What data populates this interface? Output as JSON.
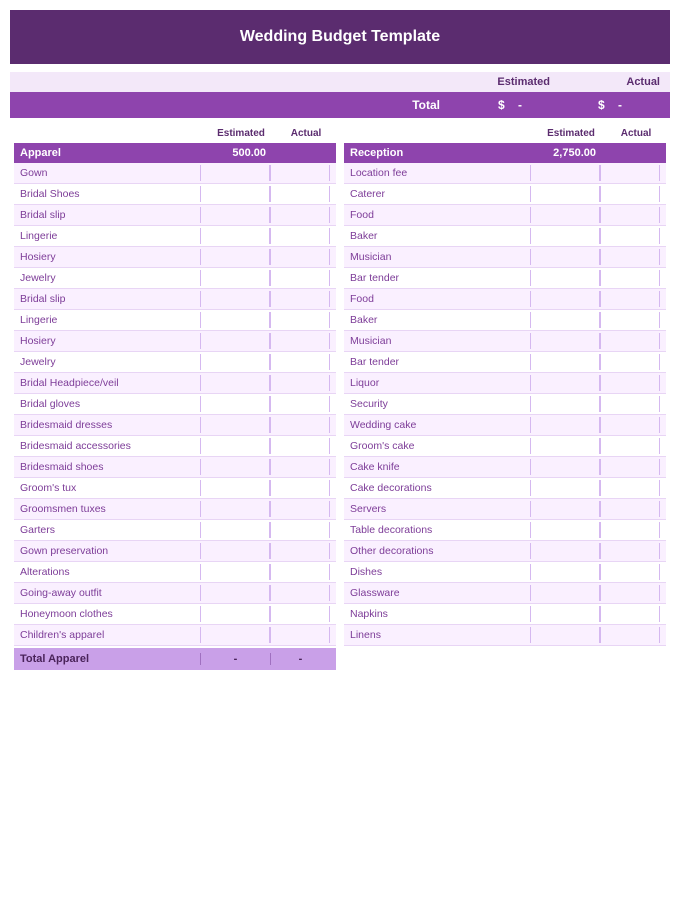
{
  "title": "Wedding Budget Template",
  "summary": {
    "estimated_label": "Estimated",
    "actual_label": "Actual"
  },
  "total_row": {
    "label": "Total",
    "estimated_symbol": "$",
    "estimated_value": "-",
    "actual_symbol": "$",
    "actual_value": "-"
  },
  "apparel": {
    "category": "Apparel",
    "estimated": "500.00",
    "items": [
      "Gown",
      "Bridal Shoes",
      "Bridal slip",
      "Lingerie",
      "Hosiery",
      "Jewelry",
      "Bridal slip",
      "Lingerie",
      "Hosiery",
      "Jewelry",
      "Bridal Headpiece/veil",
      "Bridal gloves",
      "Bridesmaid dresses",
      "Bridesmaid accessories",
      "Bridesmaid shoes",
      "Groom's tux",
      "Groomsmen tuxes",
      "Garters",
      "Gown preservation",
      "Alterations",
      "Going-away outfit",
      "Honeymoon clothes",
      "Children's apparel"
    ],
    "total_label": "Total Apparel",
    "total_estimated": "-",
    "total_actual": "-"
  },
  "reception": {
    "category": "Reception",
    "estimated": "2,750.00",
    "items": [
      "Location fee",
      "Caterer",
      "Food",
      "Baker",
      "Musician",
      "Bar tender",
      "Food",
      "Baker",
      "Musician",
      "Bar tender",
      "Liquor",
      "Security",
      "Wedding cake",
      "Groom's cake",
      "Cake knife",
      "Cake decorations",
      "Servers",
      "Table decorations",
      "Other decorations",
      "Dishes",
      "Glassware",
      "Napkins",
      "Linens"
    ]
  },
  "col_headers": {
    "name": "",
    "estimated": "Estimated",
    "actual": "Actual"
  }
}
